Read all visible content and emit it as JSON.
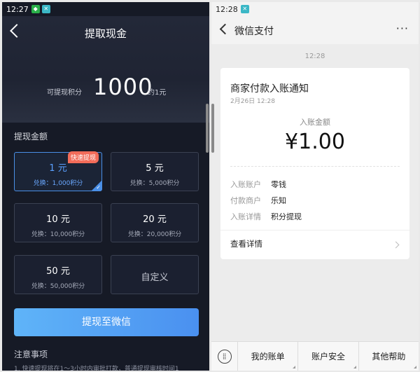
{
  "left": {
    "status": {
      "time": "12:27"
    },
    "header": {
      "title": "提取现金",
      "available_label": "可提现积分",
      "points": "1000",
      "approx": "约1元"
    },
    "section_title": "提现金额",
    "options": [
      {
        "amount": "1 元",
        "sub": "兑换：1,000积分",
        "tag": "快速提现",
        "selected": true
      },
      {
        "amount": "5 元",
        "sub": "兑换：5,000积分"
      },
      {
        "amount": "10 元",
        "sub": "兑换：10,000积分"
      },
      {
        "amount": "20 元",
        "sub": "兑换：20,000积分"
      },
      {
        "amount": "50 元",
        "sub": "兑换：50,000积分"
      },
      {
        "amount": "自定义"
      }
    ],
    "withdraw_button": "提现至微信",
    "notes_title": "注意事项",
    "note_1": "1. 快速提现将在1～3小时内审批打款，普通提现审核时间1"
  },
  "right": {
    "status": {
      "time": "12:28"
    },
    "header": {
      "title": "微信支付",
      "more": "···"
    },
    "msg_time": "12:28",
    "card": {
      "title": "商家付款入账通知",
      "date": "2月26日  12:28",
      "amount_label": "入账金额",
      "amount": "¥1.00",
      "rows": [
        {
          "k": "入账账户",
          "v": "零钱"
        },
        {
          "k": "付款商户",
          "v": "乐知"
        },
        {
          "k": "入账详情",
          "v": "积分提现"
        }
      ],
      "detail": "查看详情"
    },
    "bottom_tabs": [
      "我的账单",
      "账户安全",
      "其他帮助"
    ]
  }
}
